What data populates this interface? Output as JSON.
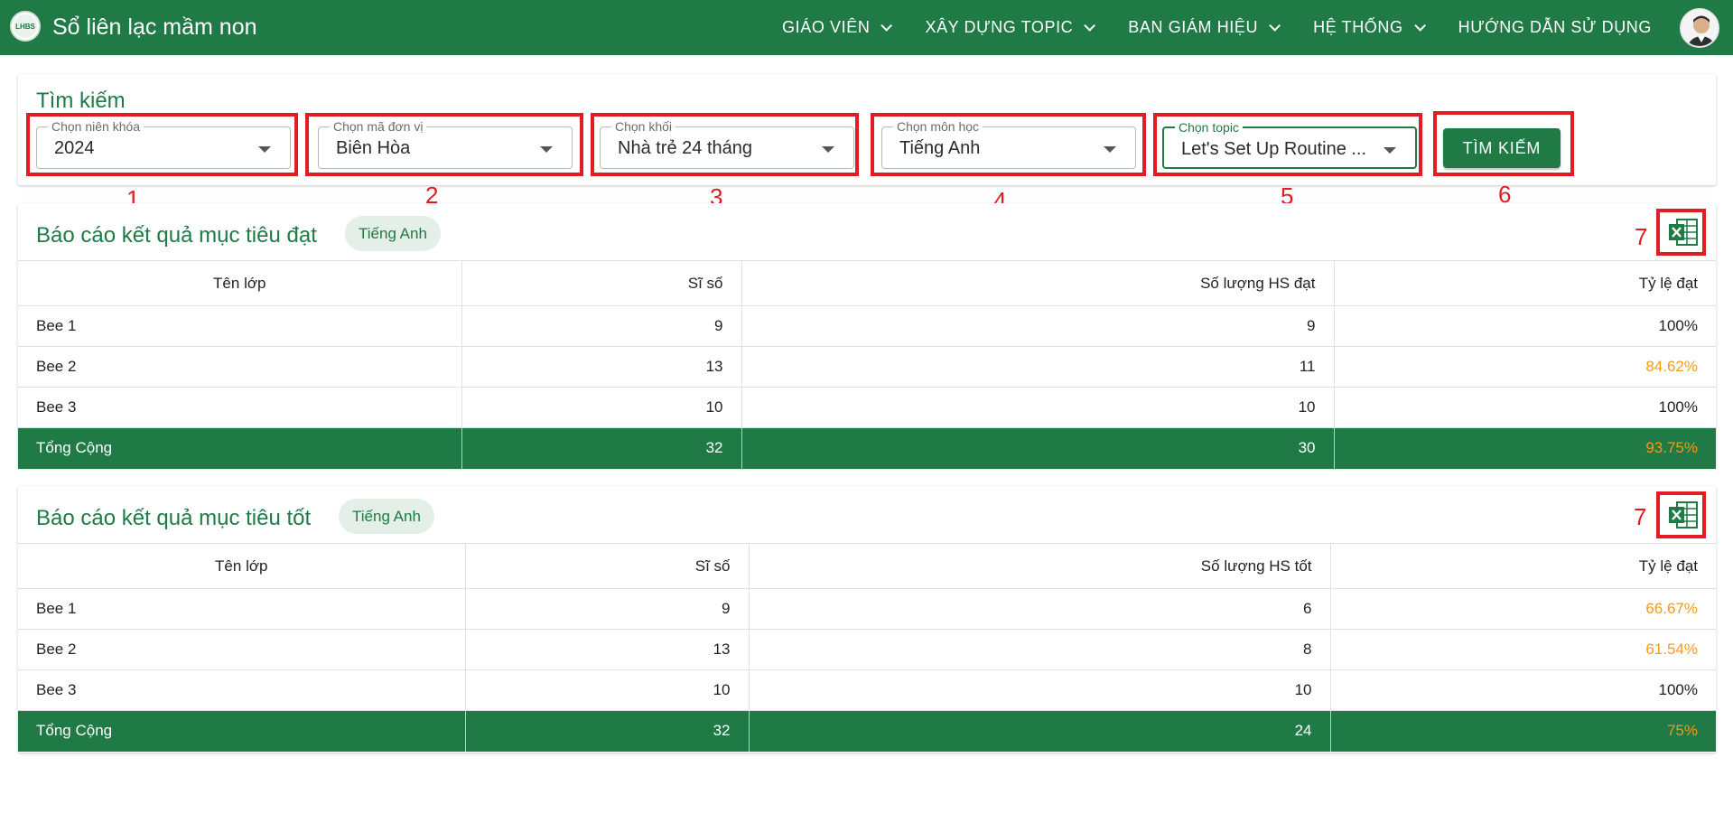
{
  "app": {
    "title": "Sổ liên lạc mầm non",
    "logo_text": "LHBS"
  },
  "nav": {
    "items": [
      {
        "label": "GIÁO VIÊN"
      },
      {
        "label": "XÂY DỰNG TOPIC"
      },
      {
        "label": "BAN GIÁM HIỆU"
      },
      {
        "label": "HỆ THỐNG"
      }
    ],
    "help_label": "HƯỚNG DẪN SỬ DỤNG"
  },
  "search": {
    "title": "Tìm kiếm",
    "fields": [
      {
        "label": "Chọn niên khóa",
        "value": "2024"
      },
      {
        "label": "Chọn mã đơn vị",
        "value": "Biên Hòa"
      },
      {
        "label": "Chọn khối",
        "value": "Nhà trẻ 24 tháng"
      },
      {
        "label": "Chọn môn học",
        "value": "Tiếng Anh"
      },
      {
        "label": "Chọn topic",
        "value": "Let's Set Up Routine ..."
      }
    ],
    "button_label": "TÌM KIẾM"
  },
  "annotations": [
    "1",
    "2",
    "3",
    "4",
    "5",
    "6",
    "7",
    "7"
  ],
  "report_achieved": {
    "title": "Báo cáo kết quả mục tiêu đạt",
    "chip": "Tiếng Anh",
    "headers": [
      "Tên lớp",
      "Sĩ số",
      "Số lượng HS đạt",
      "Tỷ lệ đạt"
    ],
    "rows": [
      {
        "name": "Bee 1",
        "size": "9",
        "count": "9",
        "rate": "100%"
      },
      {
        "name": "Bee 2",
        "size": "13",
        "count": "11",
        "rate": "84.62%"
      },
      {
        "name": "Bee 3",
        "size": "10",
        "count": "10",
        "rate": "100%"
      }
    ],
    "total": {
      "name": "Tổng Cộng",
      "size": "32",
      "count": "30",
      "rate": "93.75%"
    }
  },
  "report_good": {
    "title": "Báo cáo kết quả mục tiêu tốt",
    "chip": "Tiếng Anh",
    "headers": [
      "Tên lớp",
      "Sĩ số",
      "Số lượng HS tốt",
      "Tỷ lệ đạt"
    ],
    "rows": [
      {
        "name": "Bee 1",
        "size": "9",
        "count": "6",
        "rate": "66.67%"
      },
      {
        "name": "Bee 2",
        "size": "13",
        "count": "8",
        "rate": "61.54%"
      },
      {
        "name": "Bee 3",
        "size": "10",
        "count": "10",
        "rate": "100%"
      }
    ],
    "total": {
      "name": "Tổng Cộng",
      "size": "32",
      "count": "24",
      "rate": "75%"
    }
  },
  "colors": {
    "primary": "#1f7a45",
    "warning": "#f29b1f",
    "annotation": "#e11c24"
  }
}
